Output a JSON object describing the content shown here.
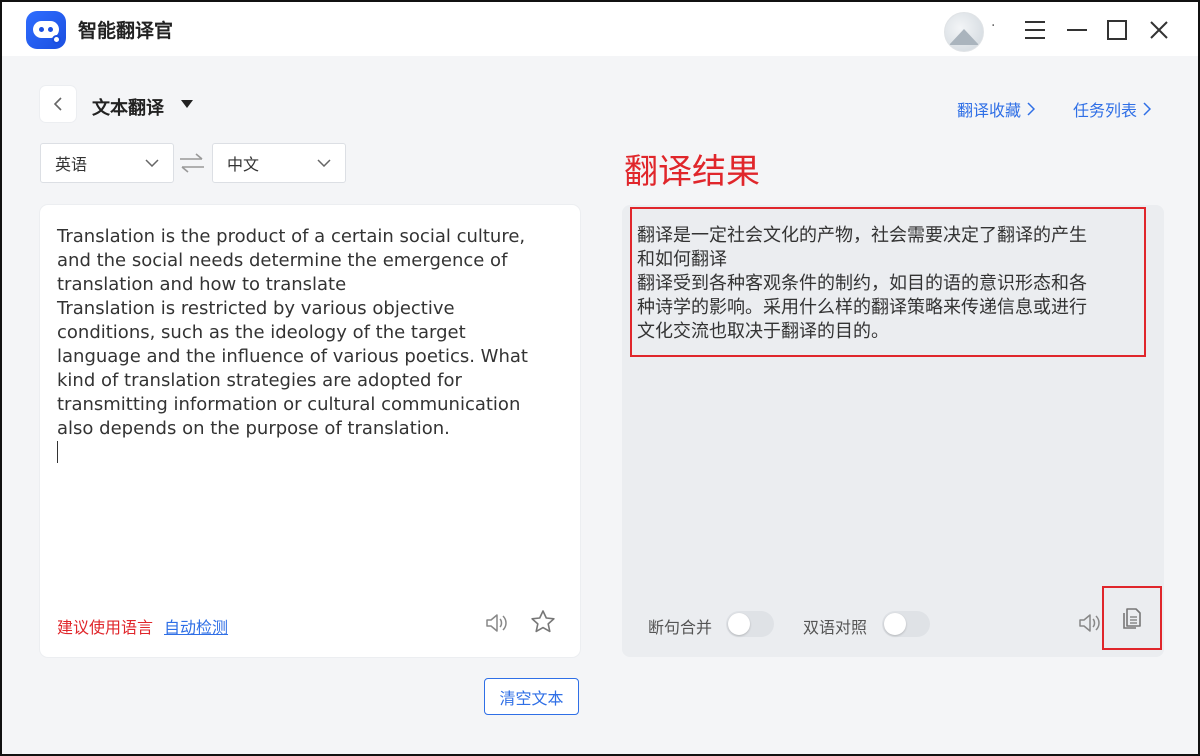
{
  "app": {
    "title": "智能翻译官",
    "avatar_text": "."
  },
  "header": {
    "mode_title": "文本翻译",
    "favorites_link": "翻译收藏",
    "tasks_link": "任务列表"
  },
  "languages": {
    "source": "英语",
    "target": "中文"
  },
  "source": {
    "text": "Translation is the product of a certain social culture,\nand the social needs determine the emergence of\ntranslation and how to translate\nTranslation is restricted by various objective\nconditions, such as the ideology of the target\nlanguage and the influence of various poetics. What\nkind of translation strategies are adopted for\ntransmitting information or cultural communication\nalso depends on the purpose of translation.",
    "suggest_label": "建议使用语言",
    "auto_detect": "自动检测",
    "clear_button": "清空文本"
  },
  "result": {
    "heading": "翻译结果",
    "text": "翻译是一定社会文化的产物，社会需要决定了翻译的产生\n和如何翻译\n翻译受到各种客观条件的制约，如目的语的意识形态和各\n种诗学的影响。采用什么样的翻译策略来传递信息或进行\n文化交流也取决于翻译的目的。",
    "merge_label": "断句合并",
    "merge_on": false,
    "bilingual_label": "双语对照",
    "bilingual_on": false
  },
  "colors": {
    "accent": "#2f6fe6",
    "highlight": "#e0262b"
  },
  "icons": [
    "app-logo",
    "menu-icon",
    "minimize-icon",
    "maximize-icon",
    "close-icon",
    "back-icon",
    "swap-icon",
    "speaker-icon",
    "star-icon",
    "copy-icon"
  ]
}
